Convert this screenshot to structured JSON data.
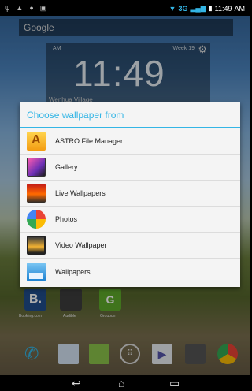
{
  "status_bar": {
    "left_icons": [
      "usb-icon",
      "notification-icon",
      "app-notification-icon",
      "image-icon"
    ],
    "network": "3G",
    "time": "11:49",
    "ampm": "AM"
  },
  "home": {
    "search_label": "Google",
    "clock": {
      "ampm": "AM",
      "week": "Week 19",
      "time": "11:49",
      "location": "Wenhua Village"
    },
    "apps": [
      {
        "name": "Booking.com",
        "letter": "B."
      },
      {
        "name": "Audible",
        "letter": ""
      },
      {
        "name": "Groupon",
        "letter": "G"
      }
    ]
  },
  "dialog": {
    "title": "Choose wallpaper from",
    "options": [
      {
        "label": "ASTRO File Manager",
        "icon": "astro-icon"
      },
      {
        "label": "Gallery",
        "icon": "gallery-icon"
      },
      {
        "label": "Live Wallpapers",
        "icon": "live-wallpapers-icon"
      },
      {
        "label": "Photos",
        "icon": "photos-icon"
      },
      {
        "label": "Video Wallpaper",
        "icon": "video-wallpaper-icon"
      },
      {
        "label": "Wallpapers",
        "icon": "wallpapers-icon"
      }
    ]
  },
  "colors": {
    "accent": "#33b5e5",
    "dialog_bg": "#f4f4f4"
  }
}
